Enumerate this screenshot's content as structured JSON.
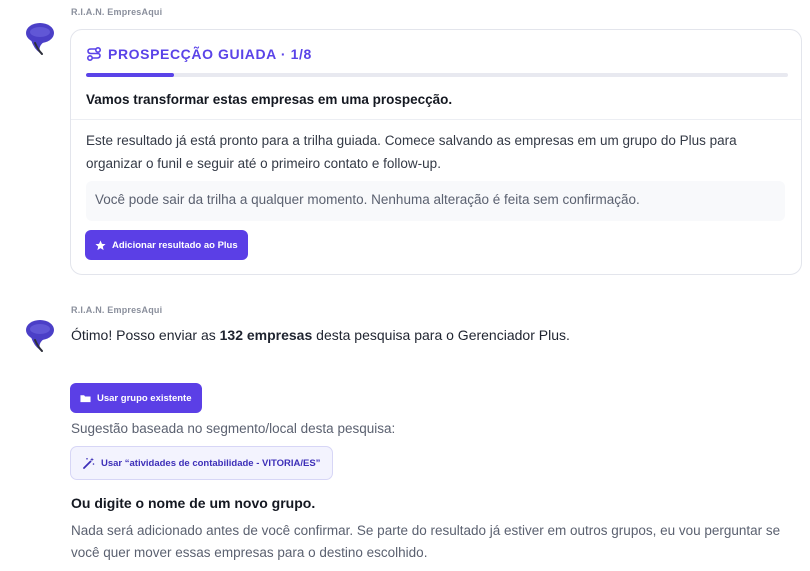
{
  "sender_name": "R.I.A.N. EmpresAqui",
  "card": {
    "title": "PROSPECÇÃO GUIADA · 1/8",
    "progress": 0.125,
    "lead": "Vamos transformar estas empresas em uma prospecção.",
    "body": "Este resultado já está pronto para a trilha guiada. Comece salvando as empresas em um grupo do Plus para organizar o funil e seguir até o primeiro contato e follow-up.",
    "note": "Você pode sair da trilha a qualquer momento. Nenhuma alteração é feita sem confirmação.",
    "button_label": "Adicionar resultado ao Plus",
    "button_icon": "star-icon",
    "title_icon": "route-icon"
  },
  "message2": {
    "text_prefix": "Ótimo! Posso enviar as ",
    "text_bold": "132 empresas",
    "text_suffix": " desta pesquisa para o Gerenciador Plus.",
    "existing_group_label": "Usar grupo existente",
    "existing_group_icon": "folder-icon",
    "hint": "Sugestão baseada no segmento/local desta pesquisa:",
    "suggest_label": "Usar “atividades de contabilidade - VITORIA/ES”",
    "suggest_icon": "magic-wand-icon",
    "new_group_heading": "Ou digite o nome de um novo grupo.",
    "footer": "Nada será adicionado antes de você confirmar. Se parte do resultado já estiver em outros grupos, eu vou perguntar se você quer mover essas empresas para o destino escolhido."
  },
  "colors": {
    "accent": "#5b3fe6",
    "avatar": "#4b3fc7",
    "progress_track": "#e8e9f0"
  }
}
